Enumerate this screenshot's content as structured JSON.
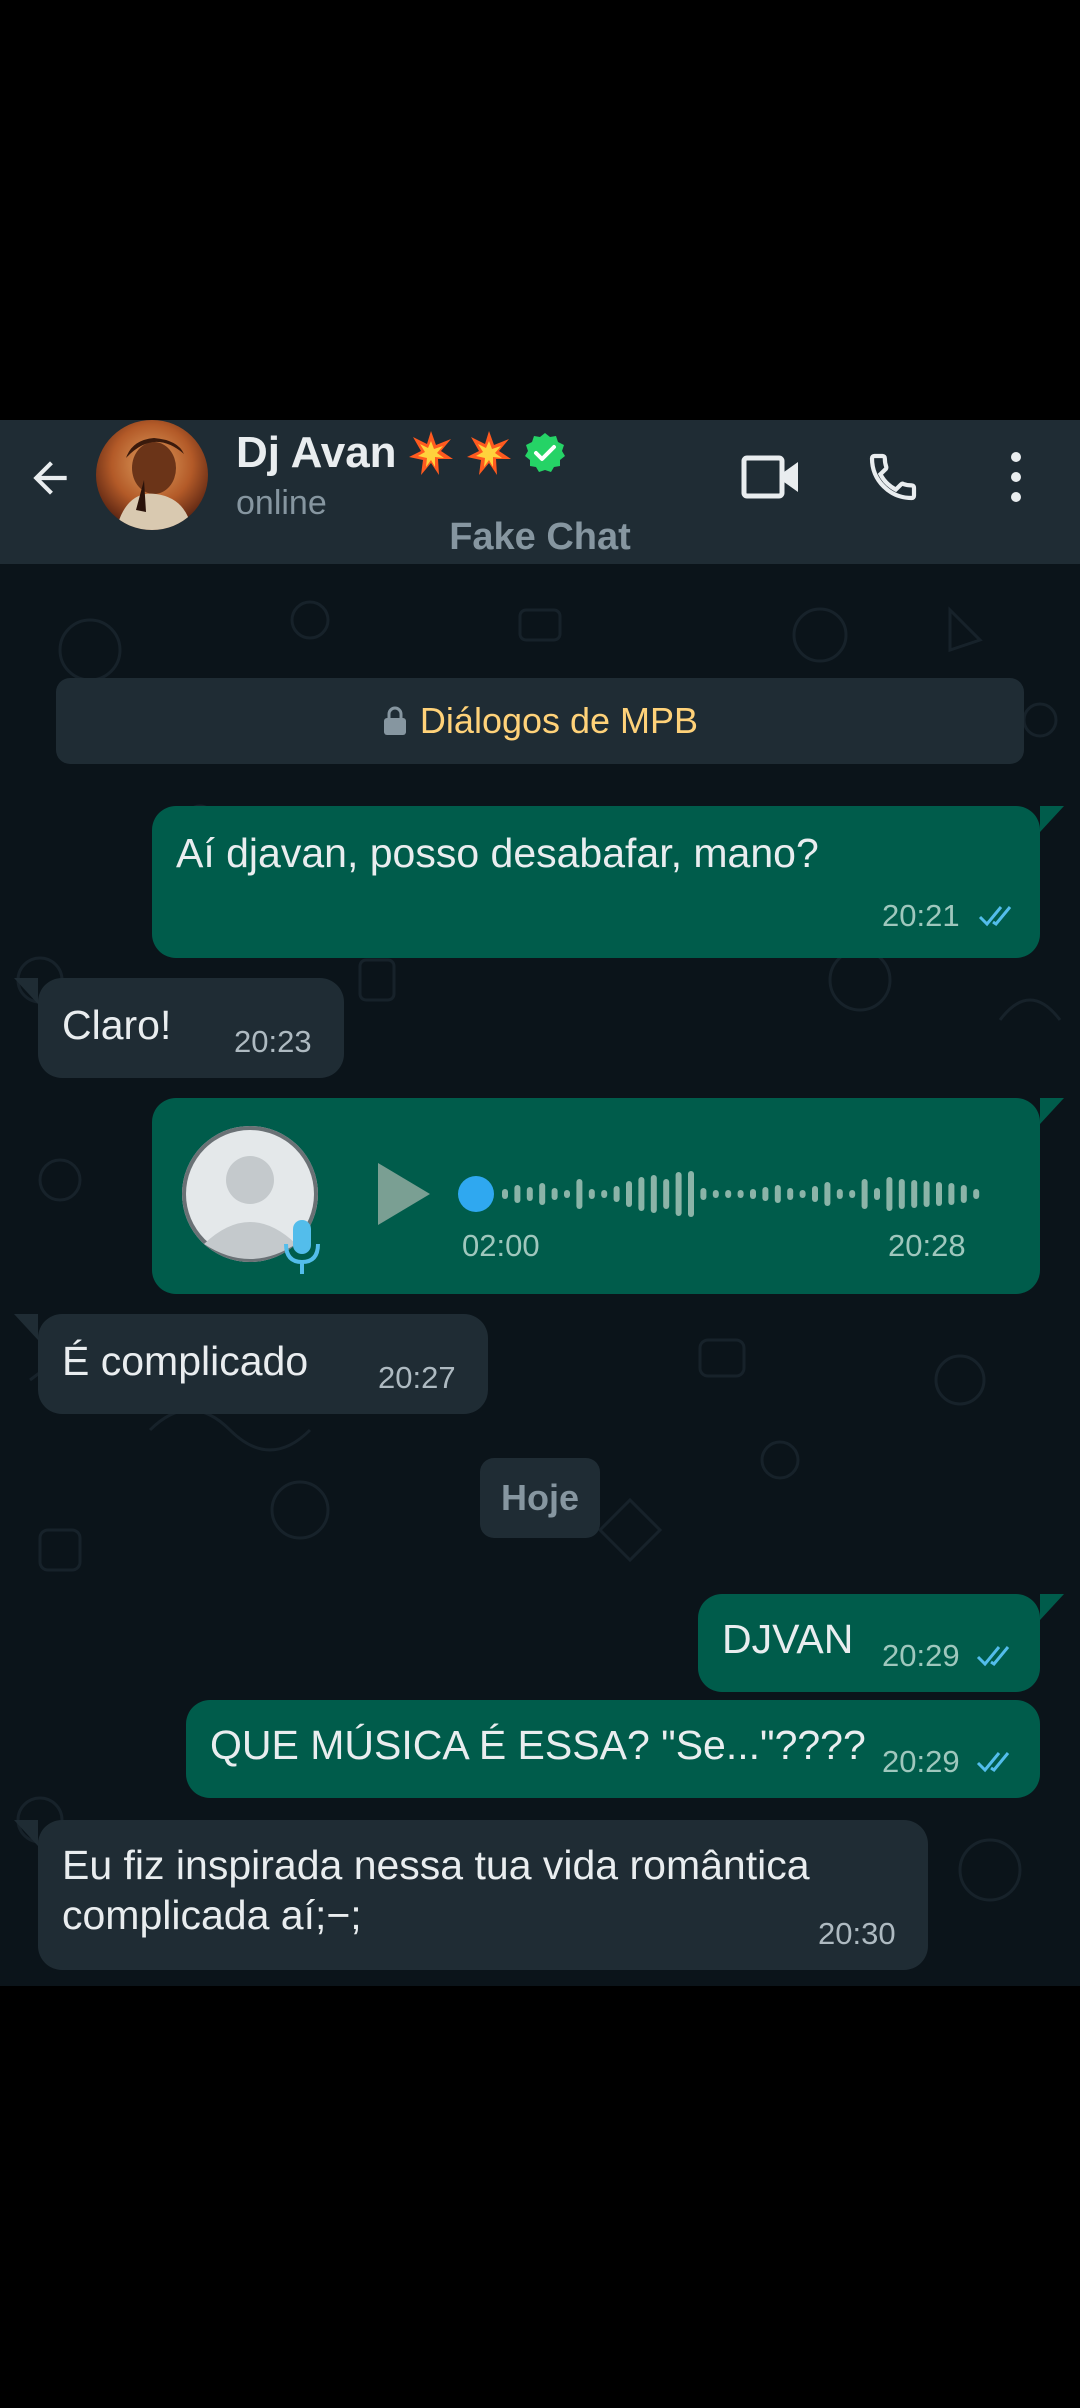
{
  "header": {
    "contact_name": "Dj Avan",
    "status": "online",
    "subtitle": "Fake Chat",
    "icons": [
      "back-arrow-icon",
      "collision-emoji-icon",
      "collision-emoji-icon",
      "verified-badge-icon",
      "video-call-icon",
      "phone-icon",
      "more-vert-icon"
    ]
  },
  "chat": {
    "encryption_banner": "Diálogos de MPB",
    "date_separator": "Hoje",
    "messages": [
      {
        "direction": "out",
        "text": "Aí djavan, posso desabafar, mano?",
        "time": "20:21",
        "status": "read"
      },
      {
        "direction": "in",
        "text": "Claro!",
        "time": "20:23"
      },
      {
        "direction": "out",
        "type": "voice",
        "duration": "02:00",
        "time": "20:28"
      },
      {
        "direction": "in",
        "text": "É complicado",
        "time": "20:27"
      },
      {
        "direction": "out",
        "text": "DJVAN",
        "time": "20:29",
        "status": "read"
      },
      {
        "direction": "out",
        "text": "QUE MÚSICA É ESSA? \"Se...\"????",
        "time": "20:29",
        "status": "read"
      },
      {
        "direction": "in",
        "text_line1": "Eu fiz inspirada nessa tua vida romântica",
        "text_line2": "complicada aí;−;",
        "time": "20:30"
      }
    ]
  },
  "colors": {
    "header_bg": "#1f2c34",
    "chat_bg": "#0b141a",
    "outgoing_bubble": "#005c4b",
    "incoming_bubble": "#1f2c34",
    "read_ticks": "#53bdeb",
    "banner_text": "#ffd279",
    "verified": "#25d366"
  }
}
